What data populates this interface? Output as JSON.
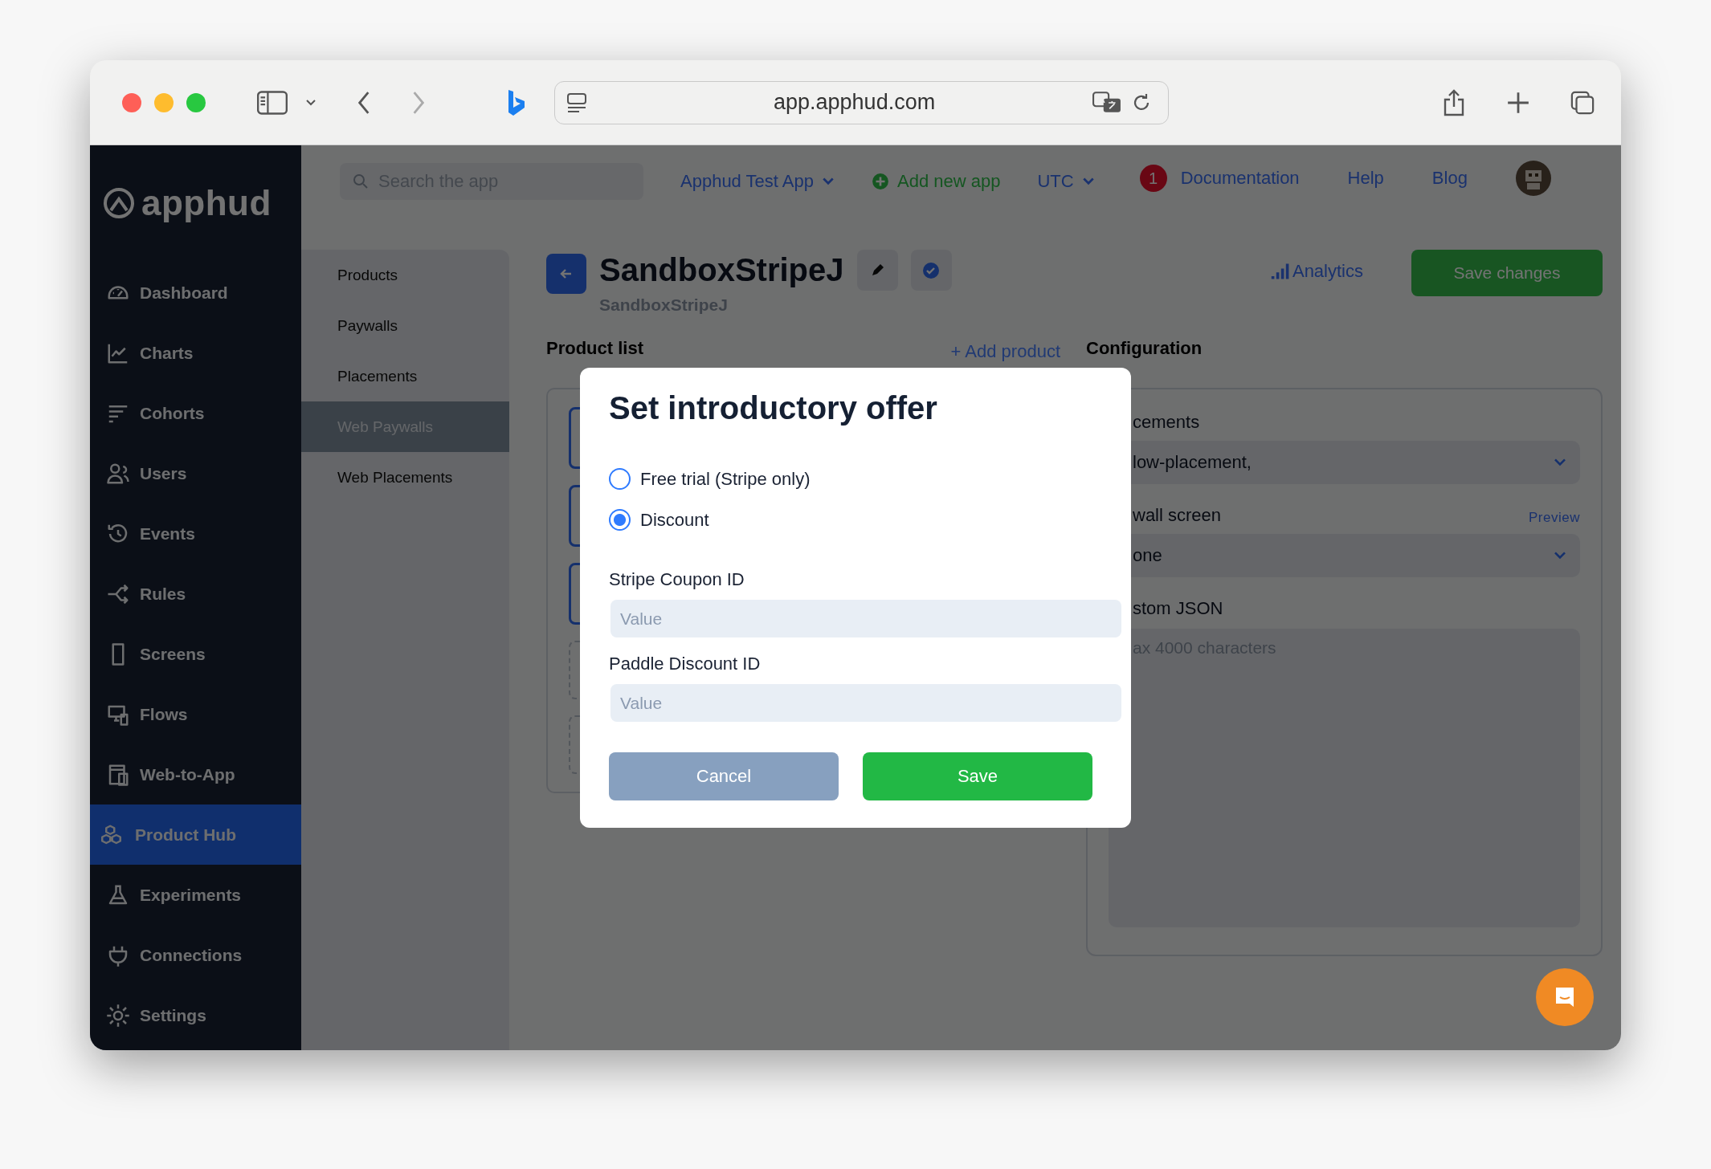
{
  "browser": {
    "url": "app.apphud.com"
  },
  "sidebar": {
    "logo": "apphud",
    "items": [
      {
        "label": "Dashboard",
        "selected": false
      },
      {
        "label": "Charts",
        "selected": false
      },
      {
        "label": "Cohorts",
        "selected": false
      },
      {
        "label": "Users",
        "selected": false
      },
      {
        "label": "Events",
        "selected": false
      },
      {
        "label": "Rules",
        "selected": false
      },
      {
        "label": "Screens",
        "selected": false
      },
      {
        "label": "Flows",
        "selected": false
      },
      {
        "label": "Web-to-App",
        "selected": false
      },
      {
        "label": "Product Hub",
        "selected": true
      },
      {
        "label": "Experiments",
        "selected": false
      },
      {
        "label": "Connections",
        "selected": false
      },
      {
        "label": "Settings",
        "selected": false
      }
    ]
  },
  "topbar": {
    "search_placeholder": "Search the app",
    "app_selector": "Apphud Test App",
    "add_app": "Add new app",
    "timezone": "UTC",
    "notification_count": "1",
    "links": [
      "Documentation",
      "Help",
      "Blog"
    ]
  },
  "subnav": {
    "items": [
      {
        "label": "Products",
        "selected": false
      },
      {
        "label": "Paywalls",
        "selected": false
      },
      {
        "label": "Placements",
        "selected": false
      },
      {
        "label": "Web Paywalls",
        "selected": true
      },
      {
        "label": "Web Placements",
        "selected": false
      }
    ]
  },
  "header": {
    "title": "SandboxStripeJ",
    "subtitle": "SandboxStripeJ",
    "analytics": "Analytics",
    "save": "Save changes"
  },
  "product_list": {
    "title": "Product list",
    "add": "+ Add product"
  },
  "configuration": {
    "title": "Configuration",
    "fields": [
      {
        "kind": "select",
        "label": "cements",
        "value": "low-placement,"
      },
      {
        "kind": "select",
        "label": "wall screen",
        "action": "Preview",
        "value": "one"
      },
      {
        "kind": "textarea",
        "label": "stom JSON",
        "placeholder": "ax 4000 characters"
      }
    ]
  },
  "modal": {
    "title": "Set introductory offer",
    "options": [
      {
        "label": "Free trial (Stripe only)",
        "selected": false
      },
      {
        "label": "Discount",
        "selected": true
      }
    ],
    "fields": [
      {
        "label": "Stripe Coupon ID",
        "placeholder": "Value"
      },
      {
        "label": "Paddle Discount ID",
        "placeholder": "Value"
      }
    ],
    "buttons": [
      {
        "kind": "secondary",
        "label": "Cancel"
      },
      {
        "kind": "primary",
        "label": "Save"
      }
    ]
  }
}
